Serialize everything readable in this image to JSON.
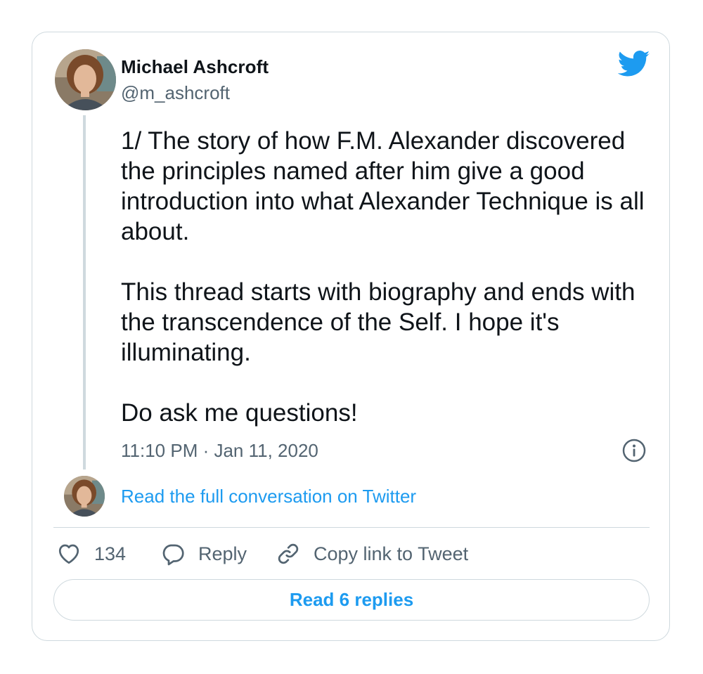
{
  "author": {
    "name": "Michael Ashcroft",
    "handle": "@m_ashcroft"
  },
  "tweet": {
    "paragraphs": [
      "1/ The story of how F.M. Alexander discovered the principles named after him give a good introduction into what Alexander Technique is all about.",
      "This thread starts with biography and ends with the transcendence of the Self. I hope it's illuminating.",
      "Do ask me questions!"
    ],
    "timestamp": "11:10 PM · Jan 11, 2020"
  },
  "conversation_link": "Read the full conversation on Twitter",
  "actions": {
    "like_count": "134",
    "reply_label": "Reply",
    "copy_label": "Copy link to Tweet"
  },
  "read_replies_label": "Read 6 replies",
  "icons": {
    "brand": "twitter-bird-icon",
    "info": "info-icon",
    "like": "heart-icon",
    "reply": "speech-bubble-icon",
    "copy": "link-icon"
  },
  "colors": {
    "accent": "#1d9bf0",
    "text": "#0f1419",
    "secondary": "#536471",
    "border": "#cfd9de"
  }
}
